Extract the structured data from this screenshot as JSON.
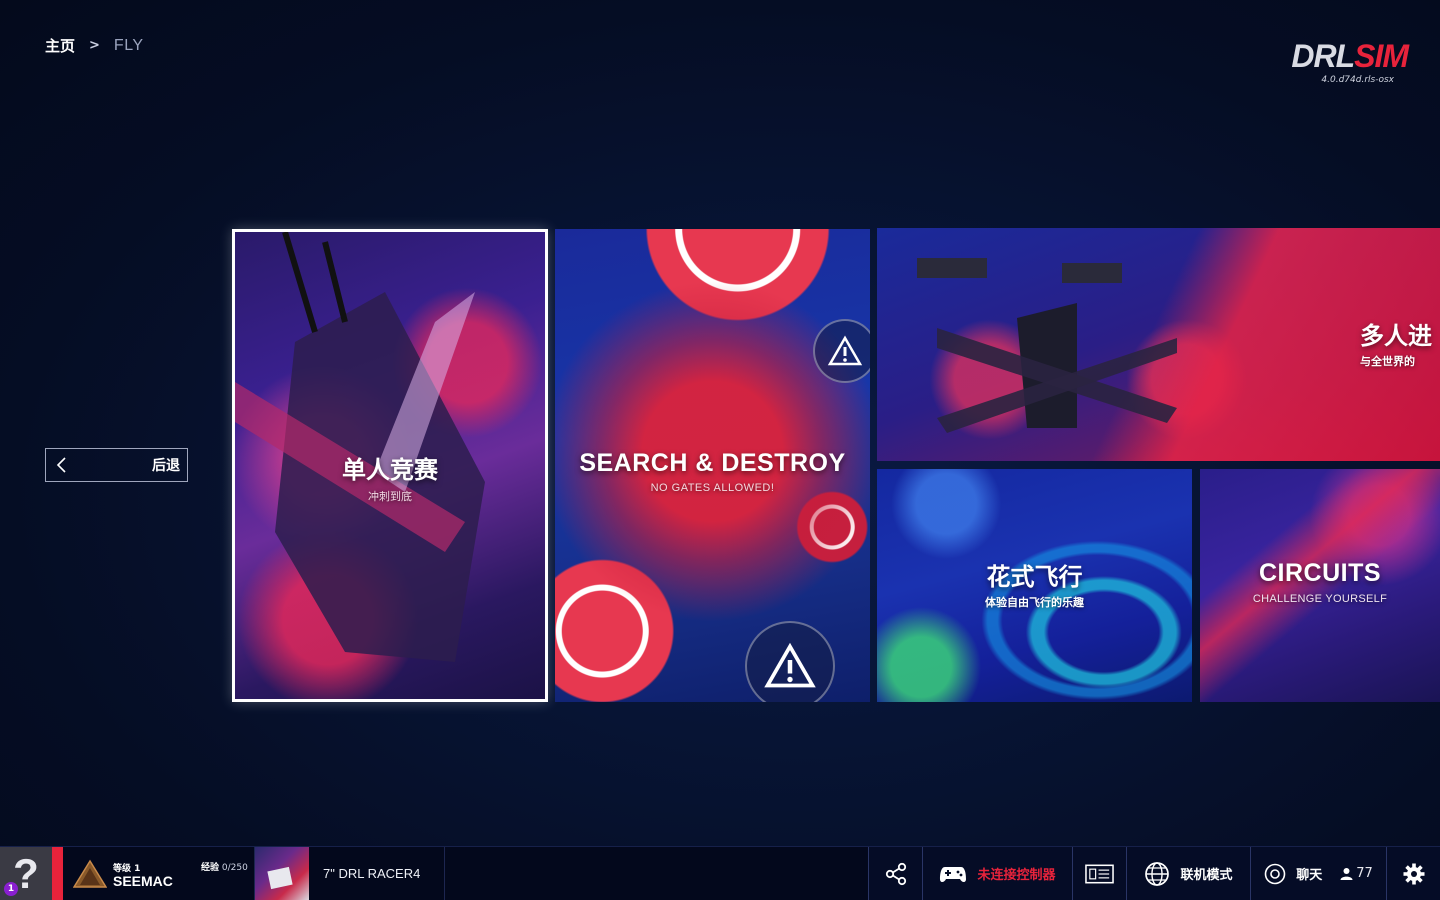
{
  "breadcrumb": {
    "home": "主页",
    "separator": ">",
    "current": "FLY"
  },
  "logo": {
    "drl": "DRL",
    "sim": "SIM",
    "version": "4.0.d74d.rls-osx"
  },
  "back_button": {
    "label": "后退"
  },
  "cards": {
    "single": {
      "title": "单人竞赛",
      "subtitle": "冲刺到底"
    },
    "search_destroy": {
      "title": "SEARCH & DESTROY",
      "subtitle": "NO GATES ALLOWED!"
    },
    "multiplayer": {
      "title": "多人进",
      "subtitle": "与全世界的"
    },
    "freestyle": {
      "title": "花式飞行",
      "subtitle": "体验自由飞行的乐趣"
    },
    "circuits": {
      "title": "CIRCUITS",
      "subtitle": "CHALLENGE YOURSELF"
    }
  },
  "bottom_bar": {
    "help_badge": "1",
    "level_label": "等级 1",
    "player_name": "SEEMAC",
    "xp_label": "经验",
    "xp_value": "0/250",
    "drone_name": "7\" DRL RACER4",
    "controller_status": "未连接控制器",
    "online_mode": "联机模式",
    "chat": "聊天",
    "online_users": "77"
  },
  "colors": {
    "accent_red": "#e8233b",
    "bar_bg": "#03081c",
    "page_bg": "#050d24"
  }
}
